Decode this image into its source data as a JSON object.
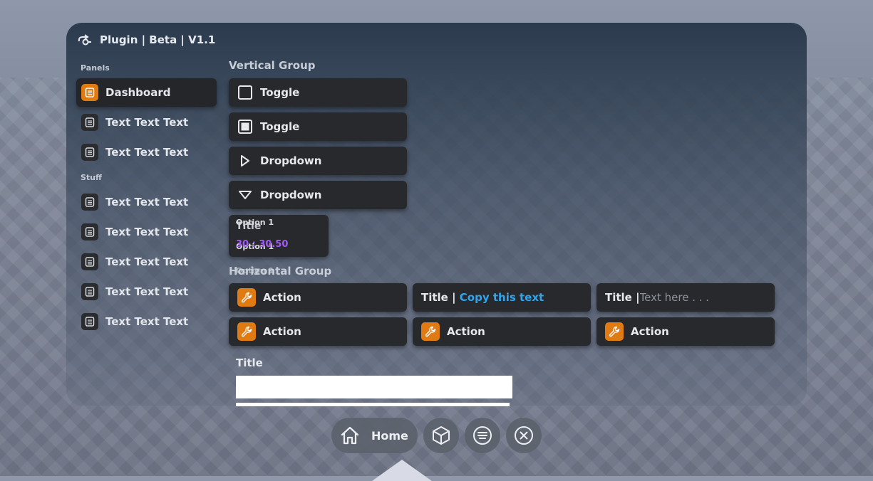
{
  "window": {
    "title": "Plugin | Beta | V1.1"
  },
  "sidebar": {
    "panels_label": "Panels",
    "stuff_label": "Stuff",
    "panels": [
      {
        "label": "Dashboard",
        "icon": "document-icon",
        "active": true
      },
      {
        "label": "Text Text Text",
        "icon": "document-icon"
      },
      {
        "label": "Text Text Text",
        "icon": "document-icon"
      }
    ],
    "stuff": [
      {
        "label": "Text Text Text",
        "icon": "document-icon"
      },
      {
        "label": "Text Text Text",
        "icon": "document-icon"
      },
      {
        "label": "Text Text Text",
        "icon": "document-icon"
      },
      {
        "label": "Text Text Text",
        "icon": "document-icon"
      },
      {
        "label": "Text Text Text",
        "icon": "document-icon"
      }
    ]
  },
  "vertical_group": {
    "label": "Vertical Group",
    "toggle_off": {
      "label": "Toggle",
      "checked": false
    },
    "toggle_on": {
      "label": "Toggle",
      "checked": true
    },
    "dropdown_closed": {
      "label": "Dropdown"
    },
    "dropdown_open": {
      "label": "Dropdown"
    },
    "dropdown_panel": {
      "title": "Title",
      "value": "30 : 30.50",
      "options": [
        "Option 1",
        "Option 1",
        "Option 1"
      ]
    }
  },
  "horizontal_group": {
    "label": "Horizontal Group",
    "action_label": "Action",
    "copy_title": "Title | ",
    "copy_text": "Copy this text",
    "input_title": "Title | ",
    "input_placeholder": "Text here . . ."
  },
  "form": {
    "title": "Title"
  },
  "taskbar": {
    "home_label": "Home"
  },
  "colors": {
    "accent": "#e07a12",
    "link": "#2fa6f0",
    "value": "#a25cf0",
    "panel": "#28292c"
  }
}
